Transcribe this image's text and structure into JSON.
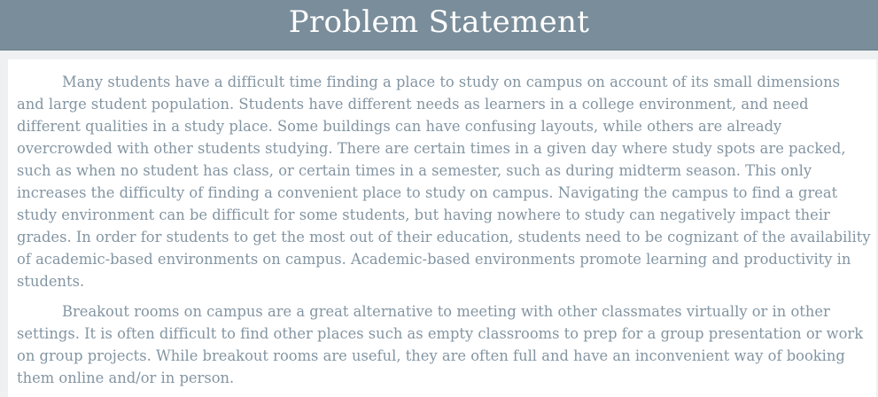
{
  "header": {
    "title": "Problem Statement"
  },
  "content": {
    "paragraphs": [
      "Many students have a difficult time finding a place to study on campus on account of its small dimensions and large student population. Students have different needs as learners in a college environment, and need different qualities in a study place. Some buildings can have confusing layouts, while others are already overcrowded with other students studying. There are certain times in a given day where study spots are packed, such as when no student has class, or certain times in a semester, such as during midterm season. This only increases the difficulty of finding a convenient place to study on campus. Navigating the campus to find a great study environment can be difficult for some students, but having nowhere to study can negatively impact their grades. In order for students to get the most out of their education, students need to be cognizant of the availability of academic-based environments on campus. Academic-based environments promote learning and productivity in students.",
      "Breakout rooms on campus are a great alternative to meeting with other classmates virtually or in other settings. It is often difficult to find other places such as empty classrooms to prep for a group presentation or work on group projects. While breakout rooms are useful, they are often full and have an inconvenient way of booking them online and/or in person."
    ]
  },
  "colors": {
    "header_background": "#7a8d9a",
    "header_text": "#ffffff",
    "page_background": "#eef0f2",
    "content_background": "#ffffff",
    "body_text": "#8395a2"
  }
}
